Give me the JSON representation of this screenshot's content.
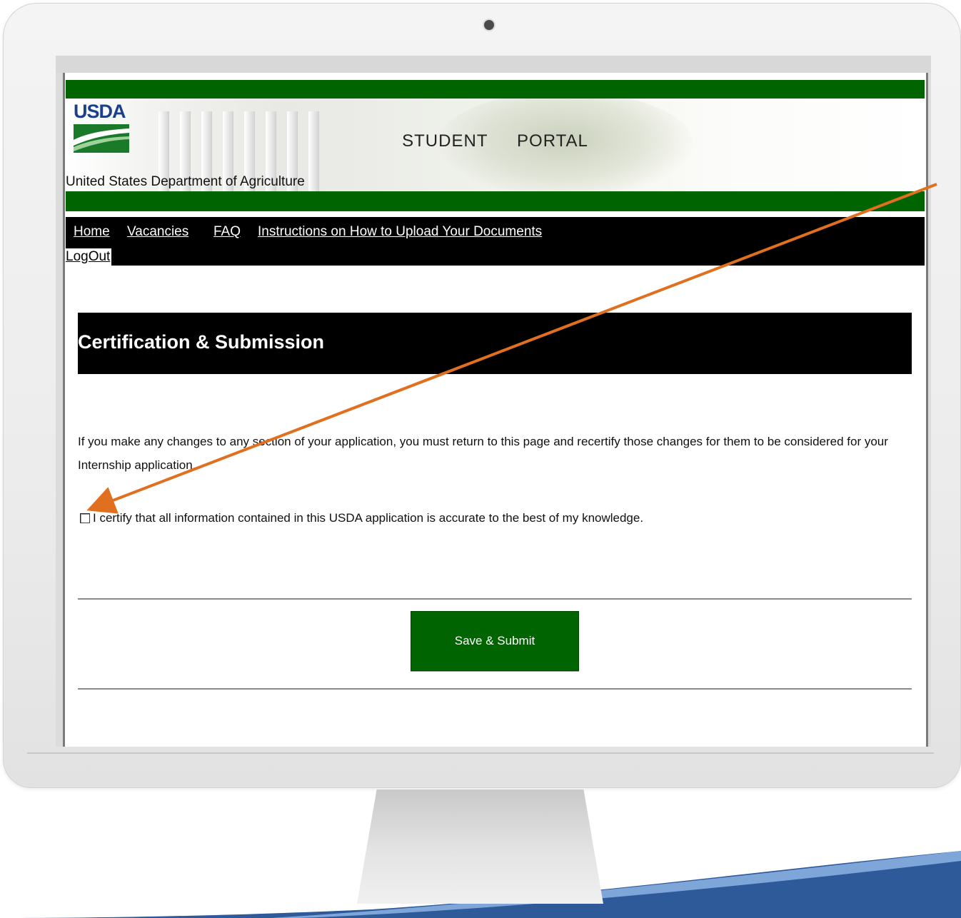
{
  "header": {
    "logo_text": "USDA",
    "portal_title": "STUDENT   PORTAL",
    "department": "United States Department of Agriculture"
  },
  "nav": {
    "items": [
      {
        "label": "Home"
      },
      {
        "label": "Vacancies"
      },
      {
        "label": "FAQ"
      },
      {
        "label": "Instructions on How to Upload Your Documents"
      }
    ],
    "logout_label": "LogOut"
  },
  "section": {
    "title": "Certification & Submission"
  },
  "notice_text": "If you make any changes to any section of your application, you must return to this page and recertify those changes for them to be considered for your Internship application.",
  "certification": {
    "label": "I certify that all information contained in this USDA application is accurate to the best of my knowledge.",
    "checked": false
  },
  "submit_label": "Save & Submit",
  "colors": {
    "usda_green": "#006400",
    "nav_black": "#000000",
    "logo_blue": "#1b3f8f",
    "annotation_arrow": "#e07020"
  }
}
